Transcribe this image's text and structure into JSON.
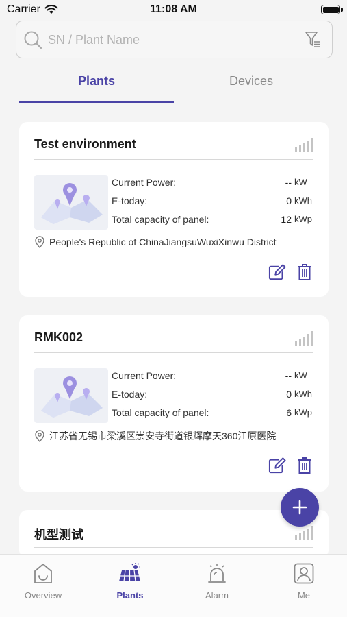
{
  "status_bar": {
    "carrier": "Carrier",
    "time": "11:08 AM"
  },
  "search": {
    "placeholder": "SN / Plant Name",
    "value": ""
  },
  "tabs": [
    {
      "label": "Plants",
      "active": true
    },
    {
      "label": "Devices",
      "active": false
    }
  ],
  "colors": {
    "accent": "#4a43a6",
    "background": "#f4f4f4",
    "card": "#ffffff"
  },
  "stat_labels": {
    "current_power": "Current Power:",
    "e_today": "E-today:",
    "capacity": "Total capacity of panel:"
  },
  "plants": [
    {
      "name": "Test environment",
      "current_power": "--",
      "current_power_unit": "kW",
      "e_today": "0",
      "e_today_unit": "kWh",
      "capacity": "12",
      "capacity_unit": "kWp",
      "address": "People's Republic of ChinaJiangsuWuxiXinwu District"
    },
    {
      "name": "RMK002",
      "current_power": "--",
      "current_power_unit": "kW",
      "e_today": "0",
      "e_today_unit": "kWh",
      "capacity": "6",
      "capacity_unit": "kWp",
      "address": "江苏省无锡市梁溪区崇安寺街道银辉摩天360江原医院"
    },
    {
      "name": "机型测试"
    }
  ],
  "bottom_nav": [
    {
      "label": "Overview",
      "icon": "home-icon",
      "active": false
    },
    {
      "label": "Plants",
      "icon": "solar-panel-icon",
      "active": true
    },
    {
      "label": "Alarm",
      "icon": "alarm-bell-icon",
      "active": false
    },
    {
      "label": "Me",
      "icon": "user-icon",
      "active": false
    }
  ]
}
